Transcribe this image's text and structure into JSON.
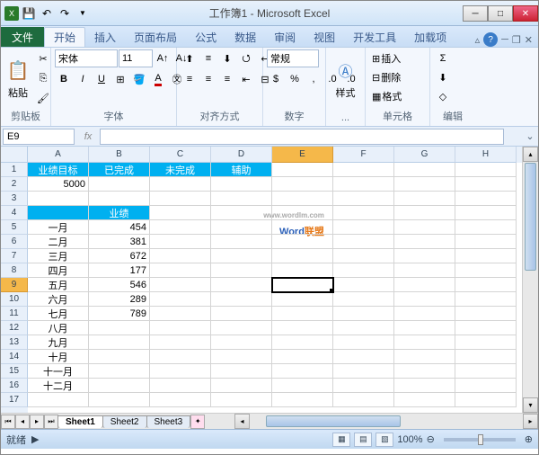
{
  "title": "工作簿1 - Microsoft Excel",
  "tabs": {
    "file": "文件",
    "items": [
      "开始",
      "插入",
      "页面布局",
      "公式",
      "数据",
      "审阅",
      "视图",
      "开发工具",
      "加载项"
    ],
    "active": 0
  },
  "ribbon": {
    "clipboard": {
      "label": "剪贴板",
      "paste": "粘贴"
    },
    "font": {
      "label": "字体",
      "name": "宋体",
      "size": "11"
    },
    "align": {
      "label": "对齐方式"
    },
    "number": {
      "label": "数字",
      "format": "常规"
    },
    "styles": {
      "label": "...",
      "btn": "样式"
    },
    "cells": {
      "label": "单元格",
      "insert": "插入",
      "delete": "删除",
      "format": "格式"
    },
    "editing": {
      "label": "编辑"
    }
  },
  "namebox": "E9",
  "cols": [
    "A",
    "B",
    "C",
    "D",
    "E",
    "F",
    "G",
    "H"
  ],
  "rows": 17,
  "headers": [
    "业绩目标",
    "已完成",
    "未完成",
    "辅助"
  ],
  "target": "5000",
  "sub_header": "业绩",
  "months": [
    "一月",
    "二月",
    "三月",
    "四月",
    "五月",
    "六月",
    "七月",
    "八月",
    "九月",
    "十月",
    "十一月",
    "十二月"
  ],
  "values": [
    "454",
    "381",
    "672",
    "177",
    "546",
    "289",
    "789",
    "",
    "",
    "",
    "",
    ""
  ],
  "active_cell": {
    "row": 9,
    "col": "E"
  },
  "sheets": [
    "Sheet1",
    "Sheet2",
    "Sheet3"
  ],
  "status": {
    "ready": "就绪",
    "zoom": "100%"
  },
  "watermark": {
    "w": "W",
    "ord": "ord",
    "lm": "联盟",
    "url": "www.wordlm.com"
  },
  "chart_data": {
    "type": "table",
    "title": "业绩",
    "categories": [
      "一月",
      "二月",
      "三月",
      "四月",
      "五月",
      "六月",
      "七月"
    ],
    "values": [
      454,
      381,
      672,
      177,
      546,
      289,
      789
    ],
    "target": 5000
  }
}
